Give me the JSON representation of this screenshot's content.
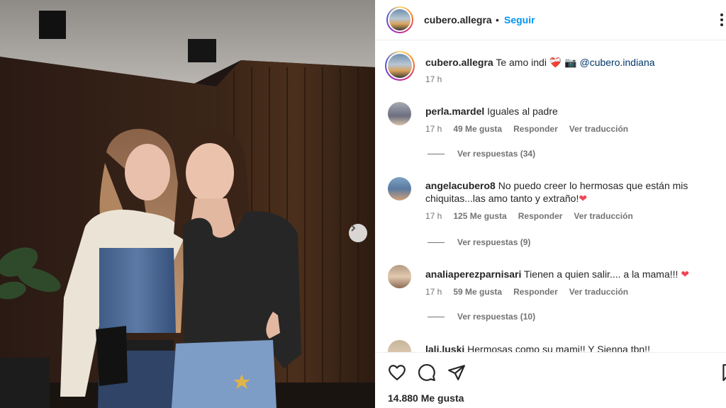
{
  "post": {
    "username": "cubero.allegra",
    "follow_label": "Seguir",
    "dot": "•",
    "caption_text": "Te amo indi",
    "caption_emoji": "❤️‍🩹 📷",
    "mention": "@cubero.indiana",
    "time": "17 h",
    "likes": "14.880 Me gusta"
  },
  "comments": [
    {
      "user": "perla.mardel",
      "text": "Iguales al padre",
      "emoji": "",
      "time": "17 h",
      "likes": "49 Me gusta",
      "reply": "Responder",
      "translate": "Ver traducción",
      "replies": "Ver respuestas (34)"
    },
    {
      "user": "angelacubero8",
      "text": "No puedo creer lo hermosas que están mis chiquitas...las amo tanto y extraño!",
      "emoji": "❤",
      "time": "17 h",
      "likes": "125 Me gusta",
      "reply": "Responder",
      "translate": "Ver traducción",
      "replies": "Ver respuestas (9)"
    },
    {
      "user": "analiaperezparnisari",
      "text": "Tienen a quien salir.... a la mama!!!",
      "emoji": "❤",
      "time": "17 h",
      "likes": "59 Me gusta",
      "reply": "Responder",
      "translate": "Ver traducción",
      "replies": "Ver respuestas (10)"
    },
    {
      "user": "lali.luski",
      "text": "Hermosas como su mami!! Y Sienna tbn!!",
      "emoji": ""
    }
  ],
  "icons": {
    "like": "heart-outline-icon",
    "comment": "comment-bubble-icon",
    "share": "paper-plane-icon",
    "save": "bookmark-icon",
    "more": "more-dots-icon",
    "next": "chevron-right-icon"
  },
  "colors": {
    "accent": "#0095f6",
    "mention": "#00376b",
    "heart": "#ed4956",
    "muted": "#737373"
  }
}
